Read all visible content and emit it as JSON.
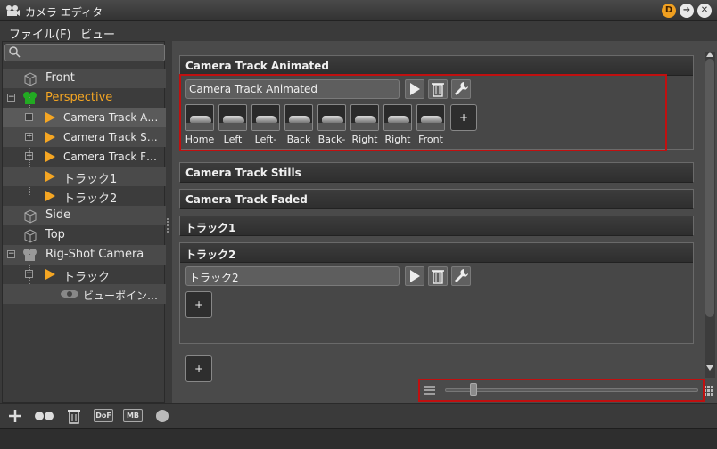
{
  "window": {
    "title": "カメラ エディタ"
  },
  "menu": {
    "items": [
      "ファイル(F)",
      "ビュー"
    ]
  },
  "search": {
    "placeholder": ""
  },
  "tree": {
    "front": "Front",
    "perspective": "Perspective",
    "cam_animated": "Camera Track A…",
    "cam_stills": "Camera Track S…",
    "cam_faded": "Camera Track F…",
    "track1": "トラック1",
    "track2": "トラック2",
    "side": "Side",
    "top": "Top",
    "rigshot": "Rig-Shot Camera",
    "track": "トラック",
    "viewpoint": "ビューポイン…"
  },
  "sections": {
    "animated": {
      "header": "Camera Track Animated",
      "name_value": "Camera Track Animated",
      "thumbs": [
        "Home",
        "Left",
        "Left-",
        "Back",
        "Back-",
        "Right",
        "Right",
        "Front"
      ],
      "add_label": "+"
    },
    "stills": {
      "header": "Camera Track Stills"
    },
    "faded": {
      "header": "Camera Track Faded"
    },
    "track1": {
      "header": "トラック1"
    },
    "track2": {
      "header": "トラック2",
      "name_value": "トラック2",
      "add_label": "+"
    }
  },
  "main_add_label": "+",
  "bottom": {
    "dof_label": "DoF",
    "mb_label": "MB"
  },
  "zoom": {
    "level": 0.1
  },
  "colors": {
    "accent_orange": "#f5a623",
    "highlight_red": "#c01010",
    "node_green": "#22aa22"
  },
  "icons": {
    "titlebar": [
      "app-camera-icon",
      "d-badge-icon",
      "go-arrow-icon",
      "close-icon"
    ],
    "toolbar": [
      "play-icon",
      "trash-icon",
      "wrench-icon"
    ],
    "bottom": [
      "add-icon",
      "camera-pair-icon",
      "trash-icon",
      "dof-icon",
      "mb-icon",
      "circle-icon"
    ],
    "zoom": [
      "list-view-icon",
      "grid-view-icon"
    ]
  }
}
